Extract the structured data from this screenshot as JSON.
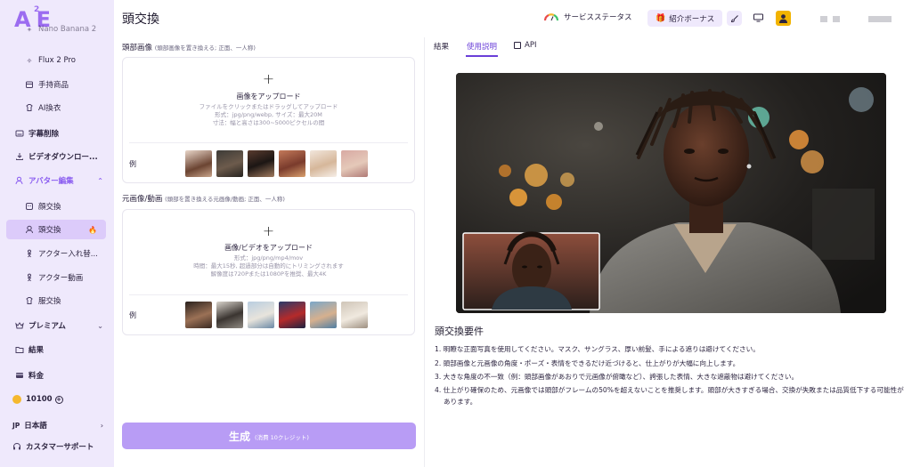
{
  "brand": {
    "logo": "A",
    "logo_sup": "2",
    "logo_tail": "E"
  },
  "sidebar": {
    "partial_item": "Nano Banana 2",
    "items": [
      {
        "label": "Flux 2 Pro",
        "icon": "sparkle-icon"
      },
      {
        "label": "手持商品",
        "icon": "box-icon"
      },
      {
        "label": "AI換衣",
        "icon": "shirt-icon"
      },
      {
        "label": "字幕削除",
        "icon": "caption-icon"
      },
      {
        "label": "ビデオダウンロー...",
        "icon": "download-icon"
      },
      {
        "label": "アバター編集",
        "icon": "user-edit-icon"
      },
      {
        "label": "顔交換",
        "icon": "face-icon"
      },
      {
        "label": "頭交換",
        "icon": "head-icon"
      },
      {
        "label": "アクター入れ替...",
        "icon": "person-swap-icon"
      },
      {
        "label": "アクター動画",
        "icon": "person-video-icon"
      },
      {
        "label": "服交換",
        "icon": "clothes-icon"
      },
      {
        "label": "プレミアム",
        "icon": "crown-icon"
      },
      {
        "label": "結果",
        "icon": "folder-icon"
      },
      {
        "label": "料金",
        "icon": "card-icon"
      }
    ],
    "credits": "10100",
    "language": "日本語",
    "language_code": "JP",
    "support": "カスタマーサポート"
  },
  "header": {
    "title": "頭交換",
    "service_status": "サービスステータス",
    "referral": "紹介ボーナス"
  },
  "head_section": {
    "label": "頭部画像",
    "hint": "(頭部画像を置き換える; 正面、一人称)",
    "upload_title": "画像をアップロード",
    "line1": "ファイルをクリックまたはドラッグしてアップロード",
    "line2": "形式：jpg/png/webp, サイズ：最大20M",
    "line3": "寸法：幅と高さは300~5000ピクセルの間",
    "examples_label": "例"
  },
  "source_section": {
    "label": "元画像/動画",
    "hint": "(頭部を置き換える元画像/動画; 正面、一人称)",
    "upload_title": "画像/ビデオをアップロード",
    "line1": "形式：jpg/png/mp4/mov",
    "line2": "時間：最大15秒, 超過部分は自動的にトリミングされます",
    "line3": "解像度は720Pまたは1080Pを推奨、最大4K",
    "examples_label": "例"
  },
  "generate": {
    "label": "生成",
    "sub": "(消費 10クレジット)"
  },
  "tabs": {
    "results": "結果",
    "instructions": "使用説明",
    "api": "API"
  },
  "requirements": {
    "title": "頭交換要件",
    "items": [
      "1. 明瞭な正面写真を使用してください。マスク、サングラス、厚い前髪、手による遮りは避けてください。",
      "2. 頭部画像と元画像の角度・ポーズ・表情をできるだけ近づけると、仕上がりが大幅に向上します。",
      "3. 大きな角度の不一致（例：頭部画像があおりで元画像が俯瞰など）、誇張した表情、大きな遮蔽物は避けてください。",
      "4. 仕上がり確保のため、元画像では頭部がフレームの50%を超えないことを推奨します。頭部が大きすぎる場合、交換が失敗または品質低下する可能性があります。"
    ]
  },
  "colors": {
    "accent": "#6a3fd8",
    "sidebar_bg": "#efe9fc",
    "active_bg": "#dccbfa",
    "generate_btn": "#b89cf5"
  }
}
